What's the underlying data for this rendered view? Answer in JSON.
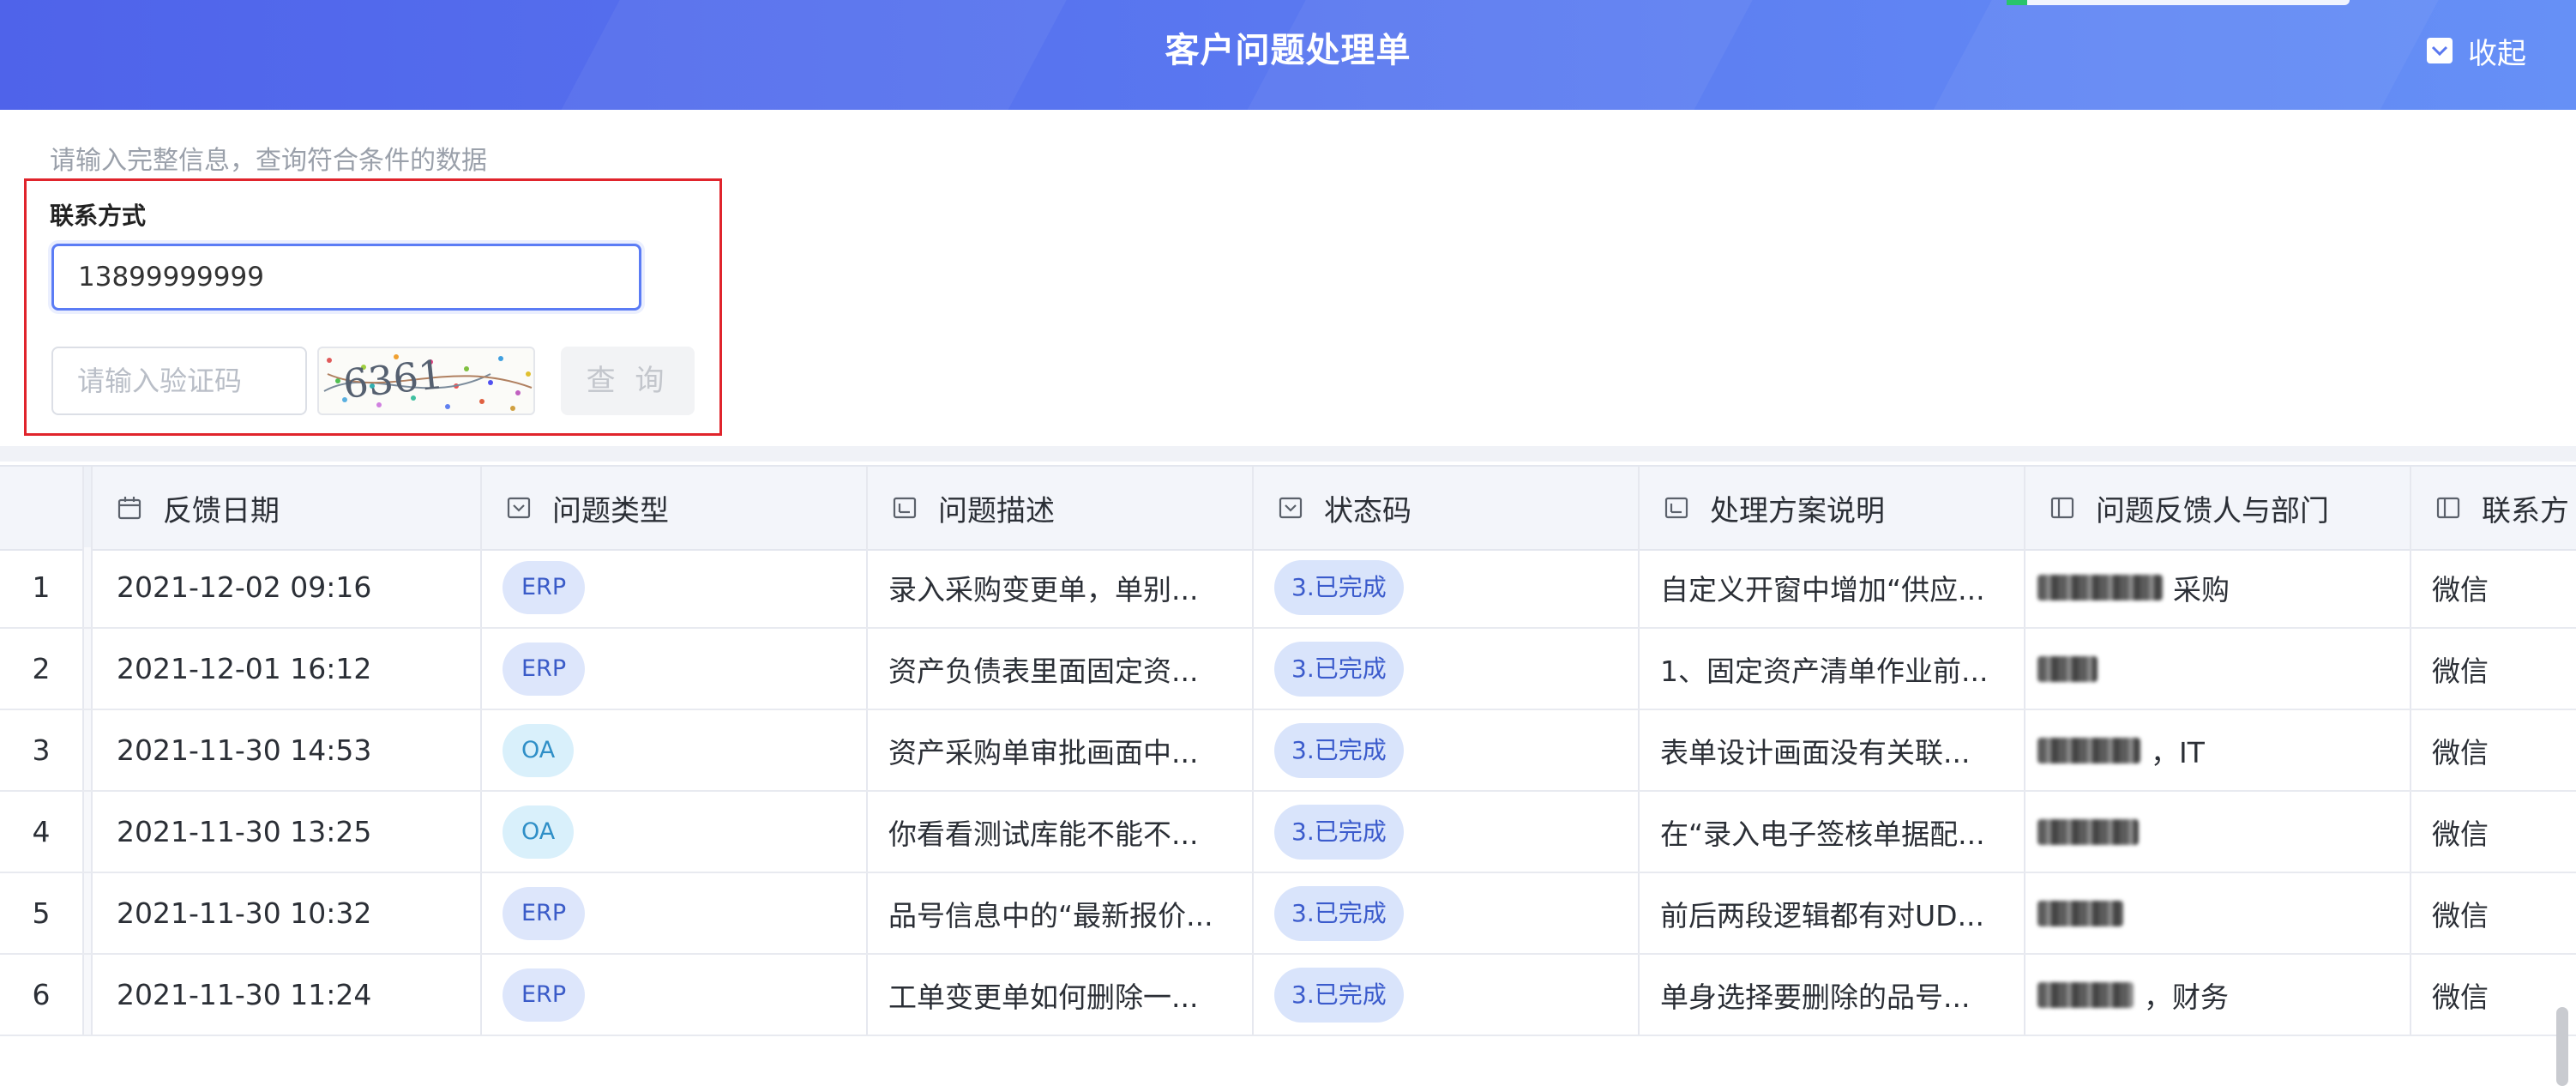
{
  "header": {
    "title": "客户问题处理单",
    "collapse_label": "收起"
  },
  "query": {
    "hint": "请输入完整信息，查询符合条件的数据",
    "contact_label": "联系方式",
    "contact_value": "13899999999",
    "captcha_placeholder": "请输入验证码",
    "captcha_text": "6361",
    "query_button": "查 询"
  },
  "table": {
    "columns": [
      {
        "label": "反馈日期",
        "icon": "calendar-icon"
      },
      {
        "label": "问题类型",
        "icon": "dropdown-icon"
      },
      {
        "label": "问题描述",
        "icon": "text-field-icon"
      },
      {
        "label": "状态码",
        "icon": "dropdown-icon"
      },
      {
        "label": "处理方案说明",
        "icon": "text-field-icon"
      },
      {
        "label": "问题反馈人与部门",
        "icon": "text-field-icon"
      },
      {
        "label": "联系方",
        "icon": "text-field-icon"
      }
    ],
    "rows": [
      {
        "index": "1",
        "date": "2021-12-02 09:16",
        "type": "ERP",
        "desc": "录入采购变更单，单别...",
        "status": "3.已完成",
        "solution": "自定义开窗中增加“供应...",
        "dept": "采购",
        "contact": "微信"
      },
      {
        "index": "2",
        "date": "2021-12-01 16:12",
        "type": "ERP",
        "desc": "资产负债表里面固定资...",
        "status": "3.已完成",
        "solution": "1、固定资产清单作业前...",
        "dept": "",
        "contact": "微信"
      },
      {
        "index": "3",
        "date": "2021-11-30 14:53",
        "type": "OA",
        "desc": "资产采购单审批画面中...",
        "status": "3.已完成",
        "solution": "表单设计画面没有关联...",
        "dept": "，IT",
        "contact": "微信"
      },
      {
        "index": "4",
        "date": "2021-11-30 13:25",
        "type": "OA",
        "desc": "你看看测试库能不能不...",
        "status": "3.已完成",
        "solution": "在“录入电子签核单据配...",
        "dept": "",
        "contact": "微信"
      },
      {
        "index": "5",
        "date": "2021-11-30 10:32",
        "type": "ERP",
        "desc": "品号信息中的“最新报价...",
        "status": "3.已完成",
        "solution": "前后两段逻辑都有对UD...",
        "dept": "",
        "contact": "微信"
      },
      {
        "index": "6",
        "date": "2021-11-30 11:24",
        "type": "ERP",
        "desc": "工单变更单如何删除一...",
        "status": "3.已完成",
        "solution": "单身选择要删除的品号...",
        "dept": "，财务",
        "contact": "微信"
      }
    ]
  },
  "colors": {
    "header_start": "#4f63ea",
    "header_end": "#6690f6",
    "erp_tag_bg": "#dde6fb",
    "erp_tag_fg": "#3a5bc8",
    "oa_tag_bg": "#d9f0fb",
    "oa_tag_fg": "#2f8fc7",
    "status_bg": "#d9e4fb",
    "highlight_border": "#e0242c"
  }
}
